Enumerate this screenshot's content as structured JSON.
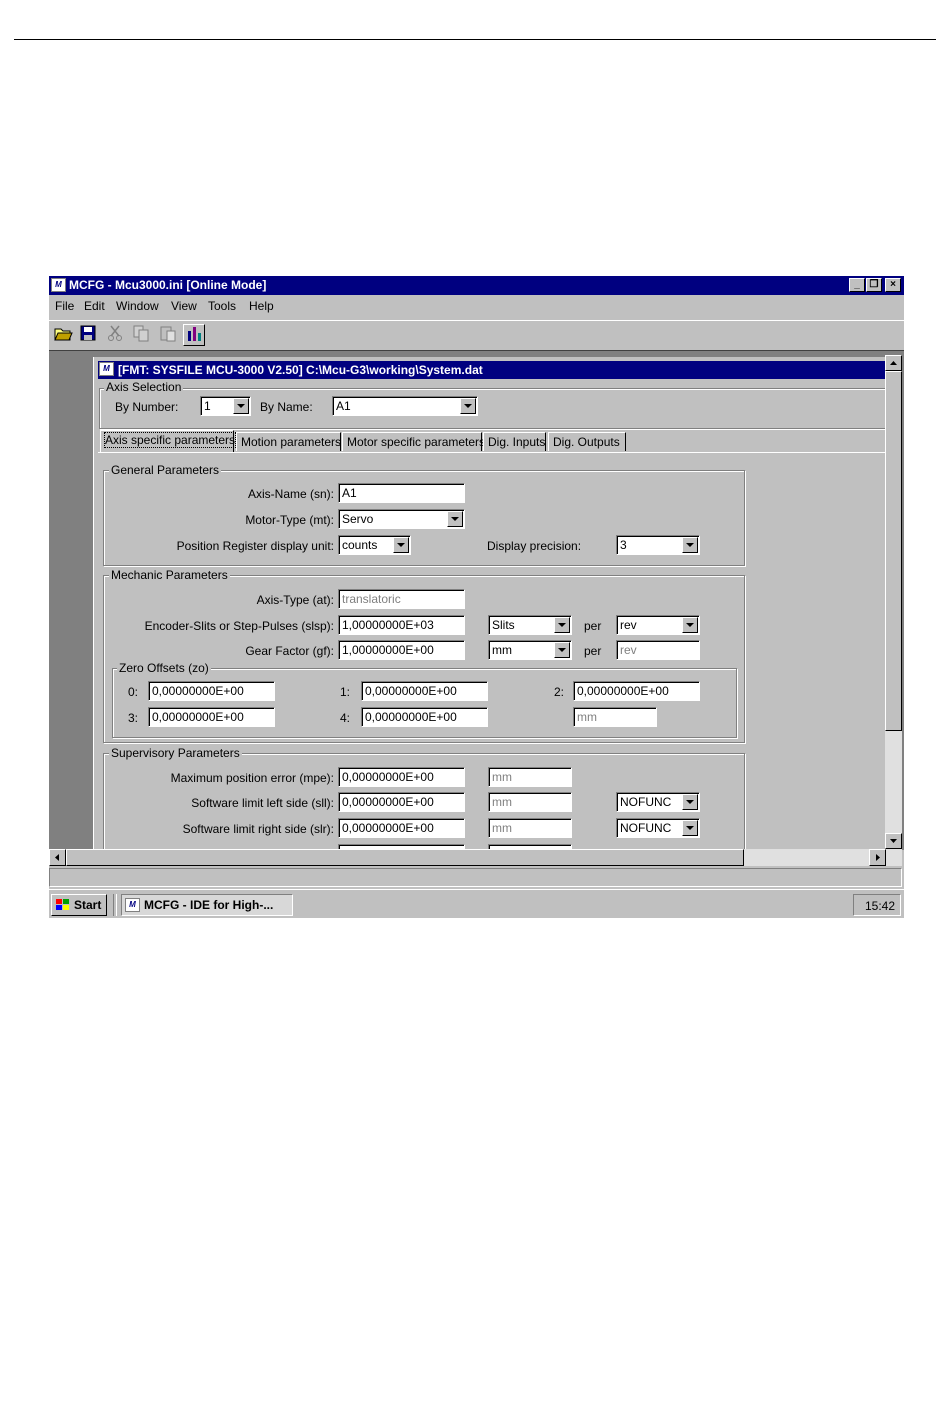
{
  "app": {
    "title": "MCFG - Mcu3000.ini [Online Mode]"
  },
  "menu": [
    "File",
    "Edit",
    "Window",
    "View",
    "Tools",
    "Help"
  ],
  "child": {
    "title": "[FMT: SYSFILE MCU-3000 V2.50] C:\\Mcu-G3\\working\\System.dat"
  },
  "axis_selection": {
    "legend": "Axis Selection",
    "by_number_label": "By Number:",
    "by_number_value": "1",
    "by_name_label": "By Name:",
    "by_name_value": "A1"
  },
  "tabs": [
    "Axis specific parameters",
    "Motion parameters",
    "Motor specific parameters",
    "Dig. Inputs",
    "Dig. Outputs"
  ],
  "general": {
    "legend": "General Parameters",
    "axis_name_label": "Axis-Name (sn):",
    "axis_name_value": "A1",
    "motor_type_label": "Motor-Type (mt):",
    "motor_type_value": "Servo",
    "unit_label": "Position Register display unit:",
    "unit_value": "counts",
    "precision_label": "Display precision:",
    "precision_value": "3"
  },
  "mechanic": {
    "legend": "Mechanic Parameters",
    "axis_type_label": "Axis-Type (at):",
    "axis_type_value": "translatoric",
    "encoder_label": "Encoder-Slits or Step-Pulses (slsp):",
    "encoder_value": "1,00000000E+03",
    "encoder_unit": "Slits",
    "per1": "per",
    "encoder_per": "rev",
    "gear_label": "Gear Factor (gf):",
    "gear_value": "1,00000000E+00",
    "gear_unit": "mm",
    "per2": "per",
    "gear_per": "rev",
    "zero": {
      "legend": "Zero Offsets (zo)",
      "l0": "0:",
      "v0": "0,00000000E+00",
      "l1": "1:",
      "v1": "0,00000000E+00",
      "l2": "2:",
      "v2": "0,00000000E+00",
      "l3": "3:",
      "v3": "0,00000000E+00",
      "l4": "4:",
      "v4": "0,00000000E+00",
      "unit": "mm"
    }
  },
  "supervisory": {
    "legend": "Supervisory Parameters",
    "mpe_label": "Maximum position error (mpe):",
    "mpe_value": "0,00000000E+00",
    "mpe_unit": "mm",
    "sll_label": "Software limit left side (sll):",
    "sll_value": "0,00000000E+00",
    "sll_unit": "mm",
    "sll_func": "NOFUNC",
    "slr_label": "Software limit right side (slr):",
    "slr_value": "0,00000000E+00",
    "slr_unit": "mm",
    "slr_func": "NOFUNC"
  },
  "taskbar": {
    "start": "Start",
    "task": "MCFG - IDE for High-...",
    "clock": "15:42"
  },
  "colors": {
    "title_bg": "#000080",
    "face": "#c0c0c0",
    "mdi_bg": "#808080"
  }
}
